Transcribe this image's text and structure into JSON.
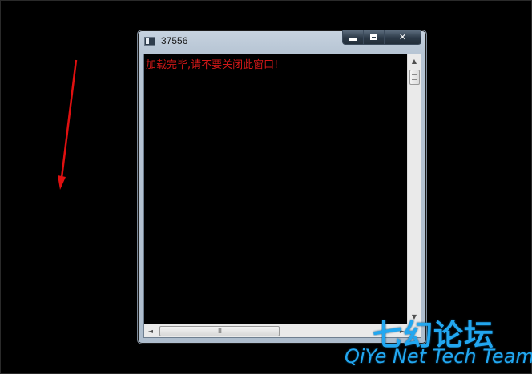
{
  "window": {
    "title": "37556",
    "close_glyph": "✕"
  },
  "console": {
    "text": "加载完毕,请不要关闭此窗口!"
  },
  "scrollbar": {
    "grip": "III",
    "up": "▲",
    "down": "▼",
    "left": "◄",
    "right": "►"
  },
  "watermark": {
    "chinese": "七幻论坛",
    "english": "QiYe Net Tech Team"
  },
  "colors": {
    "console_text": "#d01818",
    "arrow": "#e01010",
    "watermark": "#22a7f0"
  }
}
